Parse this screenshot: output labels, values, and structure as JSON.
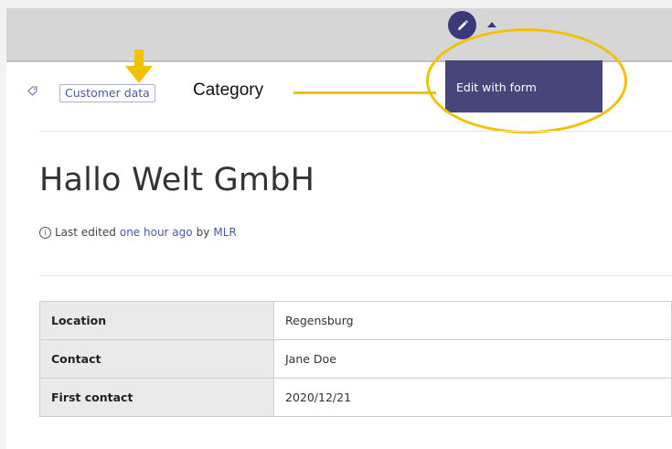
{
  "toolbar": {
    "edit_icon": "pencil-icon",
    "edit_tooltip": "Edit with form"
  },
  "annotations": {
    "category_label": "Category",
    "highlight_color": "#f2c200"
  },
  "category": {
    "icon": "tag-icon",
    "chip": "Customer data"
  },
  "page": {
    "title": "Hallo Welt GmbH",
    "meta": {
      "prefix": "Last edited",
      "time": "one hour ago",
      "by": "by",
      "user": "MLR"
    }
  },
  "properties": [
    {
      "key": "Location",
      "value": "Regensburg"
    },
    {
      "key": "Contact",
      "value": "Jane Doe"
    },
    {
      "key": "First contact",
      "value": "2020/12/21"
    }
  ],
  "colors": {
    "accent": "#3a3a78",
    "tooltip_bg": "#46467a",
    "link": "#4a56a8"
  }
}
